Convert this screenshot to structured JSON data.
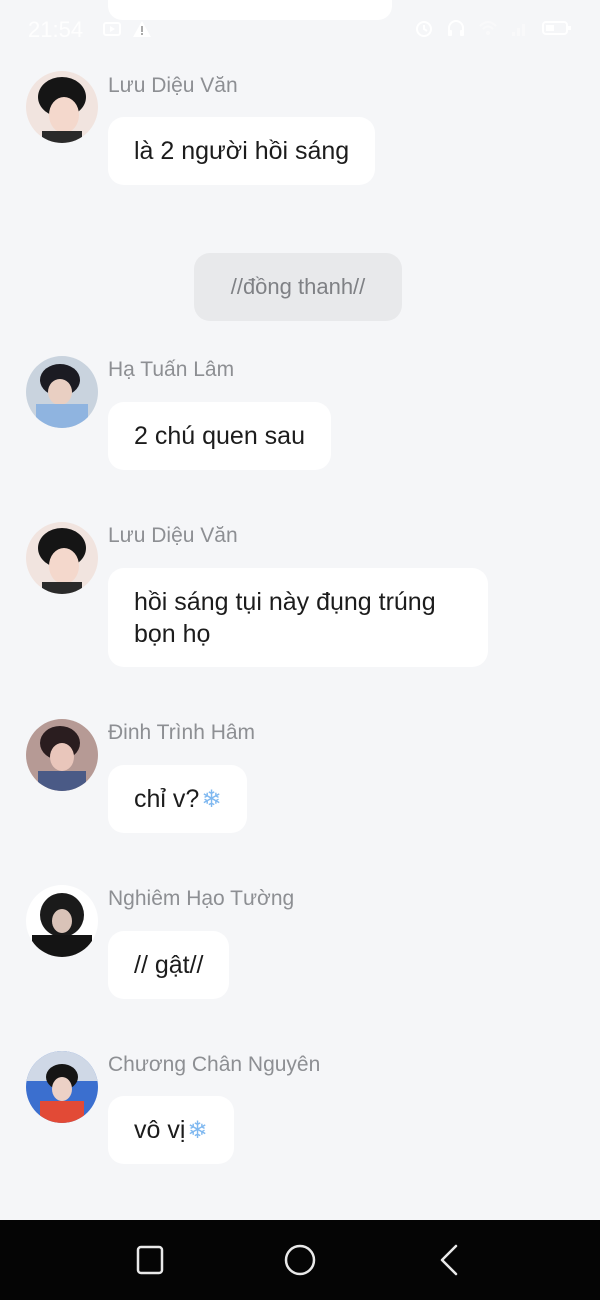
{
  "status_bar": {
    "time": "21:54",
    "icons_left": [
      "video-icon",
      "warning-icon"
    ],
    "icons_right": [
      "alarm-icon",
      "headphones-icon",
      "wifi-icon",
      "signal-icon",
      "battery-icon"
    ]
  },
  "chat": {
    "system_note": "//đồng thanh//",
    "messages": [
      {
        "sender": "Lưu Diệu Văn",
        "text": "là 2 người hồi sáng",
        "emoji": ""
      },
      {
        "sender": "Hạ Tuấn Lâm",
        "text": "2 chú quen sau",
        "emoji": ""
      },
      {
        "sender": "Lưu Diệu Văn",
        "text": "hồi sáng tụi này đụng trúng bọn họ",
        "emoji": ""
      },
      {
        "sender": "Đinh Trình Hâm",
        "text": "chỉ v?",
        "emoji": "❄"
      },
      {
        "sender": "Nghiêm Hạo Tường",
        "text": "// gật//",
        "emoji": ""
      },
      {
        "sender": "Chương Chân Nguyên",
        "text": "vô vị",
        "emoji": "❄"
      }
    ]
  },
  "nav_bar": {
    "buttons": [
      "recents-icon",
      "home-icon",
      "back-icon"
    ]
  },
  "colors": {
    "background": "#f5f6f8",
    "bubble": "#ffffff",
    "system_note_bg": "#e8e9eb",
    "sender_name": "#8d8f93",
    "nav_bar": "#050505",
    "snowflake": "#7fb8f0"
  }
}
